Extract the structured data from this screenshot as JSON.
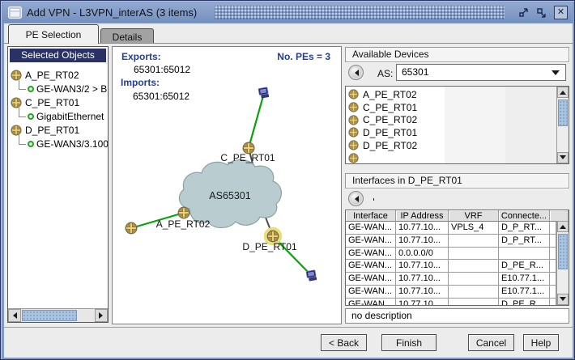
{
  "window": {
    "title": "Add VPN - L3VPN_interAS (3 items)",
    "controls": {
      "iconify": "iconify",
      "maximize": "maximize",
      "close": "close"
    }
  },
  "tabs": {
    "pe_selection": "PE Selection",
    "details": "Details"
  },
  "selected_objects": {
    "header": "Selected Objects",
    "tree": [
      {
        "device": "A_PE_RT02",
        "interface": "GE-WAN3/2 > B"
      },
      {
        "device": "C_PE_RT01",
        "interface": "GigabitEthernet"
      },
      {
        "device": "D_PE_RT01",
        "interface": "GE-WAN3/3.100"
      }
    ]
  },
  "map": {
    "exports_label": "Exports:",
    "exports_value": "65301:65012",
    "imports_label": "Imports:",
    "imports_value": "65301:65012",
    "pe_count": "No. PEs = 3",
    "cloud": "AS65301",
    "nodes": {
      "c": "C_PE_RT01",
      "a": "A_PE_RT02",
      "d": "D_PE_RT01"
    }
  },
  "available_devices": {
    "title": "Available Devices",
    "as_label": "AS:",
    "as_value": "65301",
    "devices": [
      "A_PE_RT02",
      "C_PE_RT01",
      "C_PE_RT02",
      "D_PE_RT01",
      "D_PE_RT02"
    ]
  },
  "interfaces": {
    "title": "Interfaces in D_PE_RT01",
    "columns": [
      "Interface",
      "IP Address",
      "VRF",
      "Connecte..."
    ],
    "rows": [
      [
        "GE-WAN...",
        "10.77.10...",
        "VPLS_4",
        "D_P_RT..."
      ],
      [
        "GE-WAN...",
        "10.77.10...",
        "",
        "D_P_RT..."
      ],
      [
        "GE-WAN...",
        "0.0.0.0/0",
        "",
        ""
      ],
      [
        "GE-WAN...",
        "10.77.10...",
        "",
        "D_PE_R..."
      ],
      [
        "GE-WAN...",
        "10.77.10...",
        "",
        "E10.77.1..."
      ],
      [
        "GE-WAN...",
        "10.77.10...",
        "",
        "E10.77.1..."
      ],
      [
        "GE-WAN",
        "10.77.10",
        "",
        "D_PE_R"
      ]
    ],
    "status": "no description"
  },
  "footer": {
    "back": "< Back",
    "finish": "Finish",
    "cancel": "Cancel",
    "help": "Help"
  },
  "colors": {
    "titlebar": "#7e99c4",
    "header_navy": "#2a3263",
    "label_navy": "#24408c",
    "link_green": "#0aa20a",
    "link_gray": "#4d4d4d",
    "cloud_fill": "#b9cdd1",
    "scroll_thumb": "#aac4e0"
  }
}
